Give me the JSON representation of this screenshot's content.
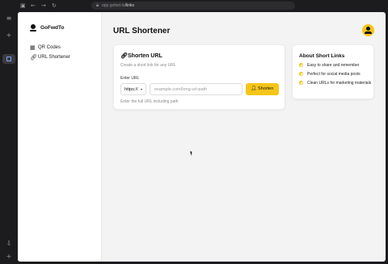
{
  "browser": {
    "url_host": "app.gofwd.to",
    "url_path": "/links",
    "lock_icon": "lock-icon"
  },
  "sidebar": {
    "brand": "GoFwdTo",
    "items": [
      {
        "label": "QR Codes",
        "icon": "qr-code-icon"
      },
      {
        "label": "URL Shortener",
        "icon": "link-icon"
      }
    ]
  },
  "header": {
    "title": "URL Shortener"
  },
  "shorten_card": {
    "title": "Shorten URL",
    "subtitle": "Create a short link for any URL",
    "field_label": "Enter URL",
    "protocol": "https://",
    "url_placeholder": "example.com/long-url-path",
    "url_value": "",
    "button_label": "Shorten",
    "hint": "Enter the full URL including path"
  },
  "about_card": {
    "title": "About Short Links",
    "features": [
      "Easy to share and remember",
      "Perfect for social media posts",
      "Clean URLs for marketing materials"
    ]
  },
  "colors": {
    "accent": "#f5c518",
    "background": "#f3f3f4",
    "card": "#ffffff"
  }
}
